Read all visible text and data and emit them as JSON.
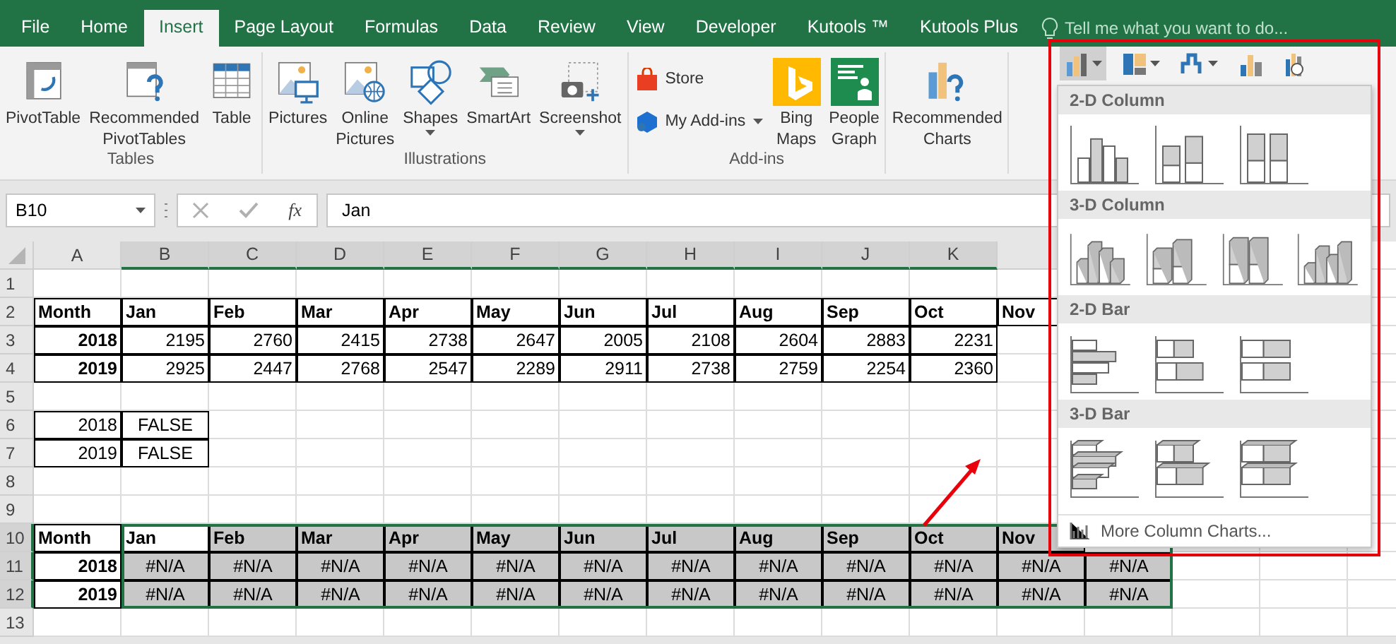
{
  "ribbon": {
    "tabs": [
      {
        "label": "File",
        "selected": false
      },
      {
        "label": "Home",
        "selected": false
      },
      {
        "label": "Insert",
        "selected": true
      },
      {
        "label": "Page Layout",
        "selected": false
      },
      {
        "label": "Formulas",
        "selected": false
      },
      {
        "label": "Data",
        "selected": false
      },
      {
        "label": "Review",
        "selected": false
      },
      {
        "label": "View",
        "selected": false
      },
      {
        "label": "Developer",
        "selected": false
      },
      {
        "label": "Kutools ™",
        "selected": false
      },
      {
        "label": "Kutools Plus",
        "selected": false
      }
    ],
    "tell_me": "Tell me what you want to do...",
    "groups": [
      {
        "label": "Tables",
        "buttons": [
          {
            "label": "PivotTable",
            "kind": "pivot",
            "dropdown": false
          },
          {
            "label": "Recommended PivotTables",
            "kind": "recpivot",
            "dropdown": false
          },
          {
            "label": "Table",
            "kind": "table",
            "dropdown": false
          }
        ]
      },
      {
        "label": "Illustrations",
        "buttons": [
          {
            "label": "Pictures",
            "kind": "pictures",
            "dropdown": false
          },
          {
            "label": "Online Pictures",
            "kind": "online",
            "dropdown": false
          },
          {
            "label": "Shapes",
            "kind": "shapes",
            "dropdown": true
          },
          {
            "label": "SmartArt",
            "kind": "smartart",
            "dropdown": false
          },
          {
            "label": "Screenshot",
            "kind": "screenshot",
            "dropdown": true
          }
        ]
      },
      {
        "label": "Add-ins",
        "buttons": [
          {
            "label": "Store",
            "kind": "store",
            "dropdown": false
          },
          {
            "label": "My Add-ins",
            "kind": "addins",
            "dropdown": true
          },
          {
            "label": "Bing Maps",
            "kind": "bing",
            "dropdown": false
          },
          {
            "label": "People Graph",
            "kind": "people",
            "dropdown": false
          }
        ]
      },
      {
        "buttons": [
          {
            "label": "Recommended Charts",
            "kind": "recchart",
            "dropdown": false
          }
        ]
      }
    ]
  },
  "formula_bar": {
    "name_box": "B10",
    "function_label": "fx",
    "formula": "Jan"
  },
  "columns": [
    {
      "label": "A",
      "selected": false
    },
    {
      "label": "B",
      "selected": true
    },
    {
      "label": "C",
      "selected": true
    },
    {
      "label": "D",
      "selected": true
    },
    {
      "label": "E",
      "selected": true
    },
    {
      "label": "F",
      "selected": true
    },
    {
      "label": "G",
      "selected": true
    },
    {
      "label": "H",
      "selected": true
    },
    {
      "label": "I",
      "selected": true
    },
    {
      "label": "J",
      "selected": true
    },
    {
      "label": "K",
      "selected": true
    }
  ],
  "rows": [
    {
      "number": "1",
      "selected": false
    },
    {
      "number": "2",
      "kind": "header",
      "selected": false,
      "cells": [
        "Month",
        "Jan",
        "Feb",
        "Mar",
        "Apr",
        "May",
        "Jun",
        "Jul",
        "Aug",
        "Sep",
        "Oct",
        "Nov"
      ]
    },
    {
      "number": "3",
      "kind": "numbers",
      "selected": false,
      "cells": [
        "2018",
        "2195",
        "2760",
        "2415",
        "2738",
        "2647",
        "2005",
        "2108",
        "2604",
        "2883",
        "2231"
      ]
    },
    {
      "number": "4",
      "kind": "numbers",
      "selected": false,
      "cells": [
        "2019",
        "2925",
        "2447",
        "2768",
        "2547",
        "2289",
        "2911",
        "2738",
        "2759",
        "2254",
        "2360"
      ]
    },
    {
      "number": "5",
      "selected": false
    },
    {
      "number": "6",
      "kind": "flags",
      "selected": false,
      "cells": [
        "2018",
        "FALSE"
      ]
    },
    {
      "number": "7",
      "kind": "flags",
      "selected": false,
      "cells": [
        "2019",
        "FALSE"
      ]
    },
    {
      "number": "8",
      "selected": false
    },
    {
      "number": "9",
      "selected": false
    },
    {
      "number": "10",
      "kind": "header",
      "selected": true,
      "cursor": true,
      "cells": [
        "Month",
        "Jan",
        "Feb",
        "Mar",
        "Apr",
        "May",
        "Jun",
        "Jul",
        "Aug",
        "Sep",
        "Oct",
        "Nov"
      ]
    },
    {
      "number": "11",
      "kind": "na",
      "selected": true,
      "cells": [
        "2018",
        "#N/A",
        "#N/A",
        "#N/A",
        "#N/A",
        "#N/A",
        "#N/A",
        "#N/A",
        "#N/A",
        "#N/A",
        "#N/A",
        "#N/A",
        "#N/A"
      ]
    },
    {
      "number": "12",
      "kind": "na",
      "selected": true,
      "cells": [
        "2019",
        "#N/A",
        "#N/A",
        "#N/A",
        "#N/A",
        "#N/A",
        "#N/A",
        "#N/A",
        "#N/A",
        "#N/A",
        "#N/A",
        "#N/A",
        "#N/A"
      ]
    },
    {
      "number": "13",
      "selected": false
    }
  ],
  "chart_menu": {
    "buttons": [
      {
        "kind": "column",
        "selected": true,
        "dropdown": true
      },
      {
        "kind": "hierarchy",
        "selected": false,
        "dropdown": true
      },
      {
        "kind": "waterfall",
        "selected": false,
        "dropdown": true
      },
      {
        "kind": "combo",
        "selected": false,
        "dropdown": false
      },
      {
        "kind": "map",
        "selected": false,
        "dropdown": false
      }
    ],
    "sections": [
      {
        "title": "2-D Column",
        "kind": "column",
        "options": [
          {
            "kind": "clustered"
          },
          {
            "kind": "stacked"
          },
          {
            "kind": "full"
          }
        ]
      },
      {
        "title": "3-D Column",
        "kind": "column3d",
        "options": [
          {
            "kind": "clustered"
          },
          {
            "kind": "stacked"
          },
          {
            "kind": "full"
          },
          {
            "kind": "depth"
          }
        ]
      },
      {
        "title": "2-D Bar",
        "kind": "bar",
        "options": [
          {
            "kind": "clustered"
          },
          {
            "kind": "stacked"
          },
          {
            "kind": "full"
          }
        ]
      },
      {
        "title": "3-D Bar",
        "kind": "bar3d",
        "options": [
          {
            "kind": "clustered"
          },
          {
            "kind": "stacked"
          },
          {
            "kind": "full"
          }
        ]
      }
    ],
    "more": "More Column Charts..."
  }
}
